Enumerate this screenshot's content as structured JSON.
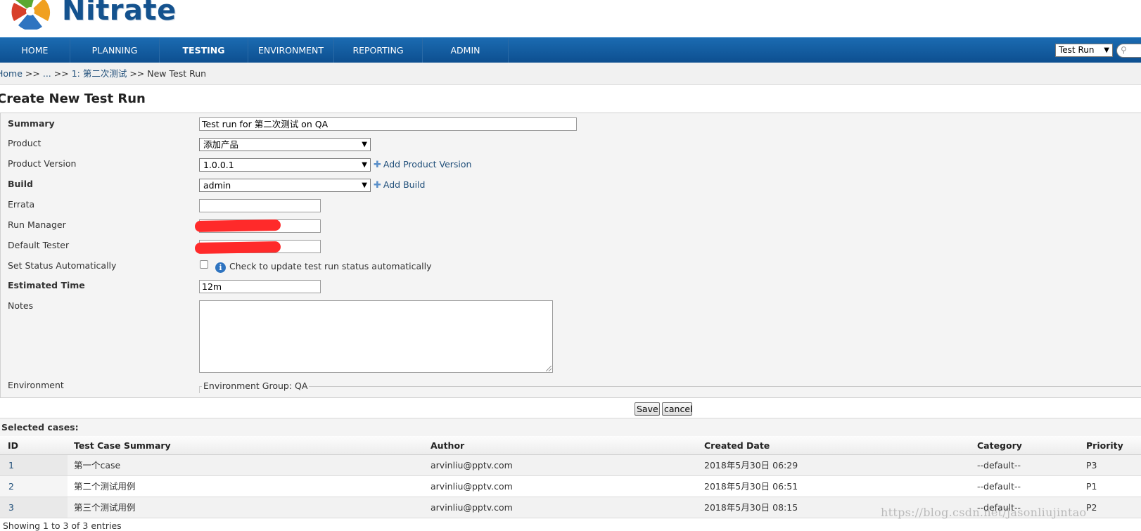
{
  "header": {
    "logo_text": "Nitrate"
  },
  "nav": {
    "items": [
      {
        "label": "HOME",
        "active": false
      },
      {
        "label": "PLANNING",
        "active": false
      },
      {
        "label": "TESTING",
        "active": true
      },
      {
        "label": "ENVIRONMENT",
        "active": false
      },
      {
        "label": "REPORTING",
        "active": false
      },
      {
        "label": "ADMIN",
        "active": false
      }
    ],
    "search_scope": "Test Run"
  },
  "breadcrumb": {
    "home": "Home",
    "sep": ">>",
    "ellipsis": "...",
    "plan": "1: 第二次测试",
    "current": "New Test Run"
  },
  "page_title": "Create New Test Run",
  "form": {
    "summary": {
      "label": "Summary",
      "value": "Test run for 第二次测试 on QA"
    },
    "product": {
      "label": "Product",
      "value": "添加产品"
    },
    "product_version": {
      "label": "Product Version",
      "value": "1.0.0.1",
      "add_link": "Add Product Version"
    },
    "build": {
      "label": "Build",
      "value": "admin",
      "add_link": "Add Build"
    },
    "errata": {
      "label": "Errata",
      "value": ""
    },
    "run_manager": {
      "label": "Run Manager"
    },
    "default_tester": {
      "label": "Default Tester"
    },
    "set_status": {
      "label": "Set Status Automatically",
      "hint": "Check to update test run status automatically",
      "checked": false
    },
    "estimated_time": {
      "label": "Estimated Time",
      "value": "12m"
    },
    "notes": {
      "label": "Notes",
      "value": ""
    },
    "environment": {
      "label": "Environment",
      "group": "Environment Group: QA"
    }
  },
  "buttons": {
    "save": "Save",
    "cancel": "cancel"
  },
  "selected": {
    "title": "Selected cases:",
    "columns": [
      "ID",
      "Test Case Summary",
      "Author",
      "Created Date",
      "Category",
      "Priority"
    ],
    "rows": [
      {
        "id": "1",
        "summary": "第一个case",
        "author": "arvinliu@pptv.com",
        "created": "2018年5月30日 06:29",
        "category": "--default--",
        "priority": "P3"
      },
      {
        "id": "2",
        "summary": "第二个测试用例",
        "author": "arvinliu@pptv.com",
        "created": "2018年5月30日 06:51",
        "category": "--default--",
        "priority": "P1"
      },
      {
        "id": "3",
        "summary": "第三个测试用例",
        "author": "arvinliu@pptv.com",
        "created": "2018年5月30日 08:15",
        "category": "--default--",
        "priority": "P2"
      }
    ],
    "info": "Showing 1 to 3 of 3 entries"
  },
  "watermark": "https://blog.csdn.net/jasonliujintao",
  "colors": {
    "nav_bg": "#0d4f90",
    "logo": "#14528e",
    "link": "#1f4e79",
    "redaction": "#ff2a2a"
  }
}
